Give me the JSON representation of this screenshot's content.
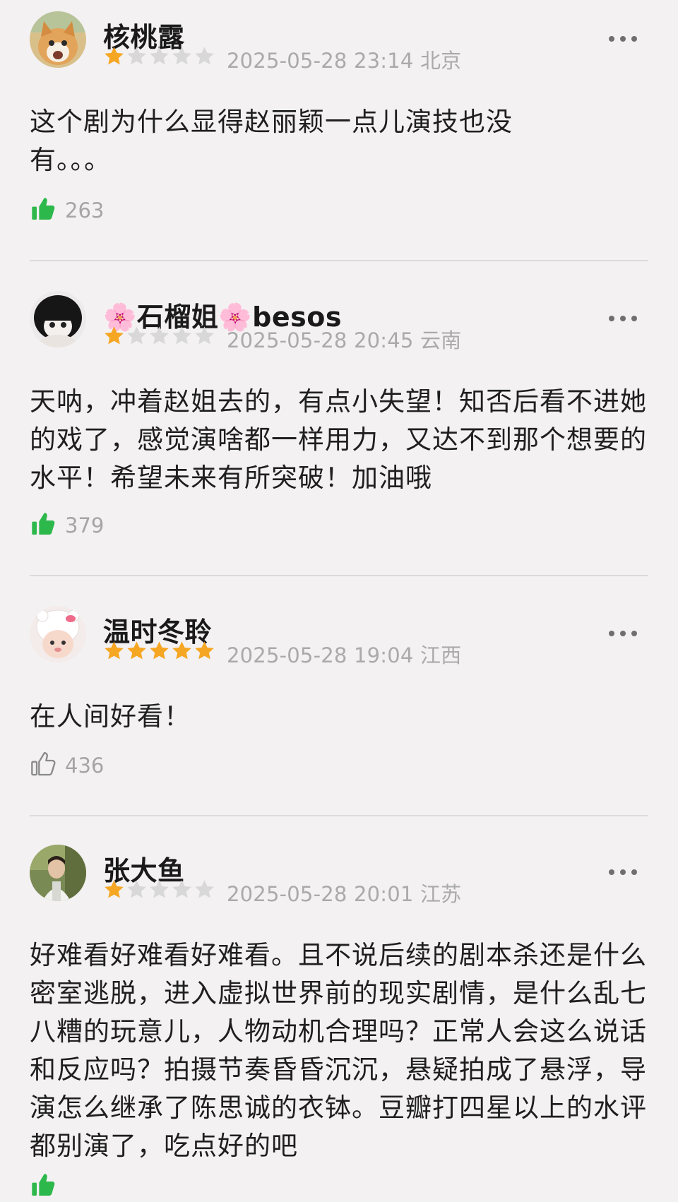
{
  "reviews": [
    {
      "username": "核桃露",
      "rating": 1,
      "datetime": "2025-05-28 23:14",
      "location": "北京",
      "text": "这个剧为什么显得赵丽颖一点儿演技也没有。。。",
      "likes": "263",
      "liked": true,
      "avatar": "orange-cat-avatar"
    },
    {
      "username": "🌸石榴姐🌸besos",
      "rating": 1,
      "datetime": "2025-05-28 20:45",
      "location": "云南",
      "text": "天呐，冲着赵姐去的，有点小失望！知否后看不进她的戏了，感觉演啥都一样用力，又达不到那个想要的水平！希望未来有所突破！加油哦",
      "likes": "379",
      "liked": true,
      "avatar": "black-hair-doll-avatar"
    },
    {
      "username": "温时冬聆",
      "rating": 5,
      "datetime": "2025-05-28 19:04",
      "location": "江西",
      "text": "在人间好看！",
      "likes": "436",
      "liked": false,
      "avatar": "hello-kitty-hat-avatar"
    },
    {
      "username": "张大鱼",
      "rating": 1,
      "datetime": "2025-05-28 20:01",
      "location": "江苏",
      "text": "好难看好难看好难看。且不说后续的剧本杀还是什么密室逃脱，进入虚拟世界前的现实剧情，是什么乱七八糟的玩意儿，人物动机合理吗？正常人会这么说话和反应吗？拍摄节奏昏昏沉沉，悬疑拍成了悬浮，导演怎么继承了陈思诚的衣钵。豆瓣打四星以上的水评都别演了，吃点好的吧",
      "likes": "",
      "liked": true,
      "avatar": "man-photo-avatar"
    }
  ],
  "colors": {
    "background": "#f3f1f2",
    "star_filled": "#f5a623",
    "star_empty": "#d8d8d8",
    "like_active": "#2db84b",
    "like_inactive": "#8a8a8a",
    "meta_text": "#aaaaaa"
  },
  "icons": {
    "more": "ellipsis-icon",
    "like": "thumbs-up-icon",
    "star": "star-icon"
  }
}
